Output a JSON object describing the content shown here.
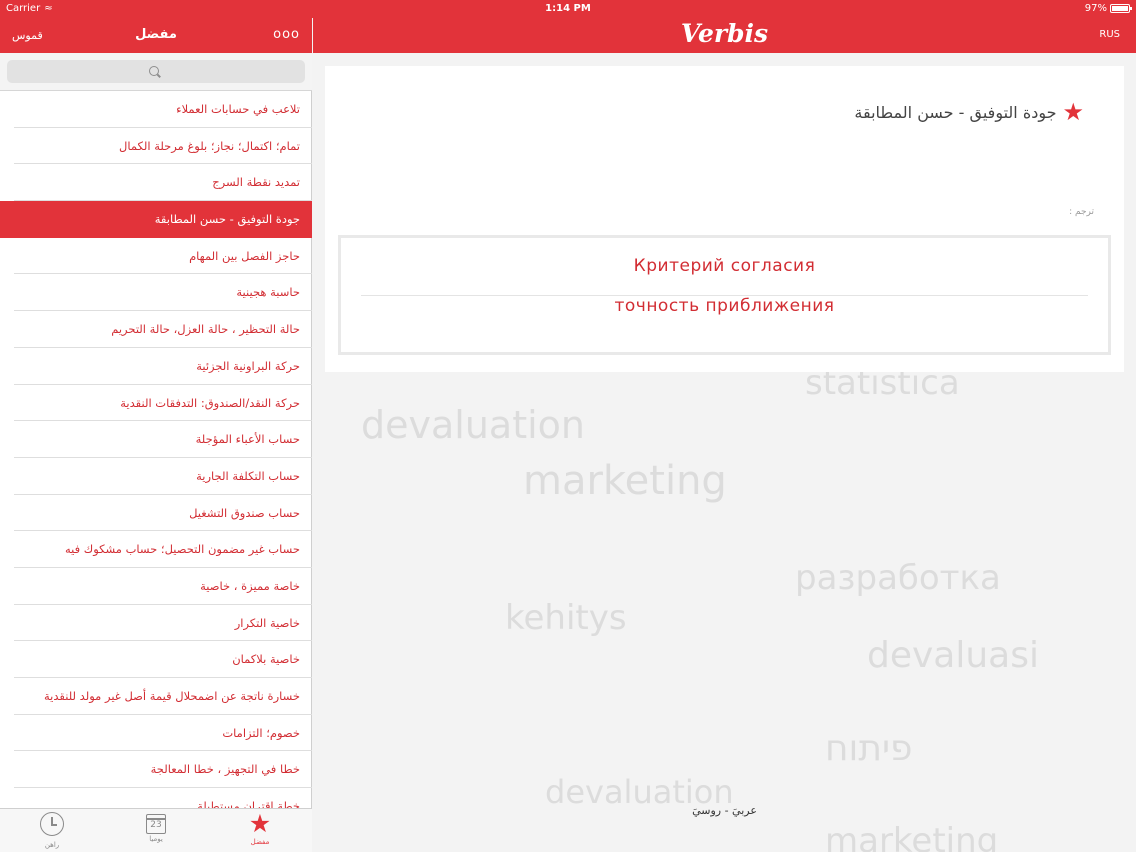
{
  "status_bar": {
    "carrier": "Carrier",
    "wifi_icon": "wifi-icon",
    "time": "1:14 PM",
    "battery": "97%"
  },
  "left_header": {
    "dictionary_button": "قموس",
    "title": "مفضل",
    "more_button": "ooo"
  },
  "favorites": [
    "تلاعب في حسابات العملاء",
    "تمام؛ اكتمال؛ نجاز؛ بلوغ مرحلة الكمال",
    "تمديد نقطة السرج",
    "جودة التوفيق - حسن المطابقة",
    "حاجز الفصل بين المهام",
    "حاسبة هجينية",
    "حالة التحظير ، حالة العزل، حالة التحريم",
    "حركة البراونية الجزئية",
    "حركة النقد/الصندوق: التدفقات النقدية",
    "حساب الأعباء المؤجلة",
    "حساب التكلفة الجارية",
    "حساب صندوق التشغيل",
    "حساب غير مضمون التحصيل؛ حساب مشكوك فيه",
    "خاصة مميزة ، خاصية",
    "خاصية التكرار",
    "خاصية بلاكمان",
    "خسارة ناتجة عن اضمحلال قيمة أصل غير مولد للنقدية",
    "خصوم؛ التزامات",
    "خطا في التجهيز ، خطا المعالجة",
    "خطة اقتران مستطيلة"
  ],
  "selected_index": 3,
  "tab_bar": {
    "history": {
      "label": "راهن",
      "icon": "clock-icon"
    },
    "today": {
      "label": "يوميا",
      "icon": "calendar-icon",
      "day": "23"
    },
    "favorites": {
      "label": "مفضل",
      "icon": "star-icon"
    }
  },
  "right_header": {
    "logo": "Verbis",
    "language_button": "RUS"
  },
  "entry": {
    "term": "جودة التوفيق - حسن المطابقة",
    "translate_label": "ترجم :",
    "translations": [
      "Критерий согласия",
      "точность приближения"
    ]
  },
  "dictionary_direction": "عربيَ - روسيَ",
  "background_words": [
    "statistica",
    "devaluation",
    "marketing",
    "разработка",
    "kehitys",
    "devaluasi",
    "פיתוח",
    "devaluation",
    "marketing"
  ],
  "colors": {
    "brand_red": "#e2333a",
    "text_red": "#d22d33"
  }
}
